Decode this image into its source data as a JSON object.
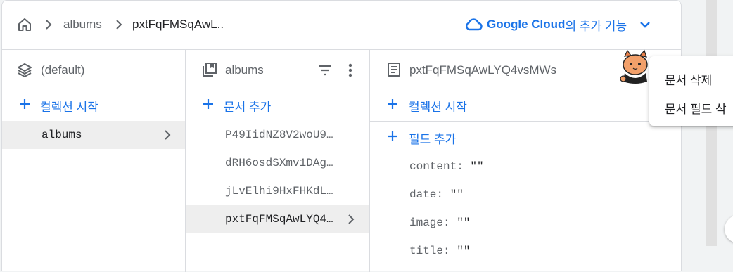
{
  "breadcrumb": {
    "items": [
      "albums",
      "pxtFqFMSqAwL.."
    ],
    "home_icon": "home-icon",
    "separator_icon": "chevron-right-icon"
  },
  "header": {
    "brand": "Google Cloud",
    "suffix": "의 추가 기능",
    "cloud_icon": "cloud-icon",
    "expand_icon": "chevron-down-icon"
  },
  "columns": {
    "root": {
      "title": "(default)",
      "icon": "database-stack-icon",
      "action": "컬렉션 시작",
      "items": [
        "albums"
      ]
    },
    "collection": {
      "title": "albums",
      "icon": "collection-icon",
      "filter_icon": "filter-icon",
      "more_icon": "more-vert-icon",
      "action": "문서 추가",
      "items": [
        "P49IidNZ8V2woU9…",
        "dRH6osdSXmv1DAg…",
        "jLvElhi9HxFHKdL…",
        "pxtFqFMSqAwLYQ4…"
      ]
    },
    "document": {
      "title": "pxtFqFMSqAwLYQ4vsMWs",
      "icon": "document-icon",
      "start_collection": "컬렉션 시작",
      "add_field": "필드 추가",
      "fields": [
        {
          "name": "content:",
          "value": "\"\""
        },
        {
          "name": "date:",
          "value": "\"\""
        },
        {
          "name": "image:",
          "value": "\"\""
        },
        {
          "name": "title:",
          "value": "\"\""
        }
      ]
    }
  },
  "context_menu": {
    "items": [
      "문서 삭제",
      "문서 필드 삭"
    ]
  },
  "colors": {
    "accent": "#1a73e8",
    "selected_row": "#eeeeee",
    "border": "#dadce0"
  }
}
